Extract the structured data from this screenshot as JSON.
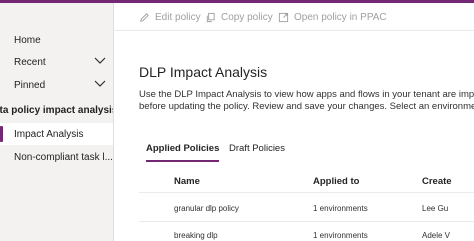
{
  "colors": {
    "accent": "#742774",
    "sidebar_bg": "#f3f2f1",
    "disabled_text": "#a19f9d"
  },
  "sidebar": {
    "items": [
      {
        "label": "Home",
        "icon": "home-icon"
      },
      {
        "label": "Recent",
        "icon": "clock-icon",
        "expandable": true
      },
      {
        "label": "Pinned",
        "icon": "pin-icon",
        "expandable": true
      },
      {
        "label": "ata policy impact analysis",
        "section_header": true
      },
      {
        "label": "Impact Analysis",
        "selected": true
      },
      {
        "label": "Non-compliant task l..."
      }
    ]
  },
  "toolbar": {
    "edit_label": "Edit policy",
    "copy_label": "Copy policy",
    "open_label": "Open policy in PPAC"
  },
  "main": {
    "title": "DLP Impact Analysis",
    "description_line1": "Use the DLP Impact Analysis to view how apps and flows in your tenant are impac",
    "description_line2": "before updating the policy. Review and save your changes. Select an environment"
  },
  "tabs": [
    {
      "label": "Applied Policies",
      "active": true
    },
    {
      "label": "Draft Policies",
      "active": false
    }
  ],
  "table": {
    "columns": [
      "Name",
      "Applied to",
      "Create"
    ],
    "rows": [
      [
        "granular dlp policy",
        "1 environments",
        "Lee Gu"
      ],
      [
        "breaking dlp",
        "1 environments",
        "Adele V"
      ]
    ]
  }
}
